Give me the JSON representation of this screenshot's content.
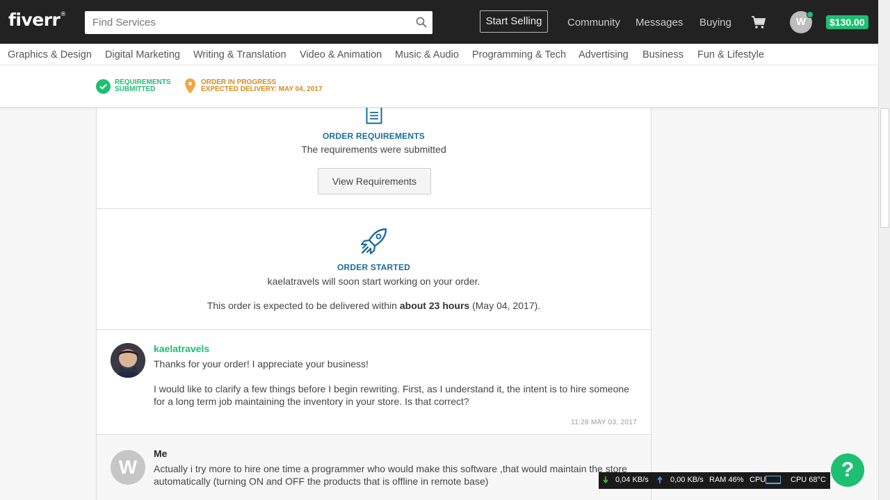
{
  "header": {
    "logo": "fiverr",
    "logo_mark": "®",
    "search_placeholder": "Find Services",
    "search_icon": "search-icon",
    "start_selling": "Start Selling",
    "nav": [
      "Community",
      "Messages",
      "Buying"
    ],
    "cart_icon": "cart-icon",
    "avatar_initial": "W",
    "balance": "$130.00",
    "colors": {
      "bar": "#222222",
      "brand_green": "#1dbf73"
    }
  },
  "categories": [
    "Graphics & Design",
    "Digital Marketing",
    "Writing & Translation",
    "Video & Animation",
    "Music & Audio",
    "Programming & Tech",
    "Advertising",
    "Business",
    "Fun & Lifestyle"
  ],
  "status": {
    "requirements_line1": "REQUIREMENTS",
    "requirements_line2": "SUBMITTED",
    "progress_line1": "ORDER IN PROGRESS",
    "progress_line2": "EXPECTED DELIVERY: MAY 04, 2017",
    "colors": {
      "done": "#1dbf73",
      "in_progress": "#d68a1f"
    }
  },
  "requirements": {
    "icon": "document-icon",
    "title": "ORDER REQUIREMENTS",
    "text": "The requirements were submitted",
    "button": "View Requirements"
  },
  "started": {
    "icon": "rocket-icon",
    "title": "ORDER STARTED",
    "text": "kaelatravels will soon start working on your order.",
    "delivery_prefix": "This order is expected to be delivered within",
    "delivery_bold": "about 23 hours",
    "delivery_suffix": "(May 04, 2017)."
  },
  "messages": [
    {
      "name": "kaelatravels",
      "para1": "Thanks for your order! I appreciate your business!",
      "para2": "I would like to clarify a few things before I begin rewriting. First, as I understand it, the intent is to hire someone for a long term job maintaining the inventory in your store. Is that correct?",
      "time": "11:28  MAY 03, 2017"
    },
    {
      "name": "Me",
      "initial": "W",
      "para1": "Actually i try more to hire one time a programmer who would make this software ,that would maintain the store automatically (turning ON and OFF the products that is offline in remote base)"
    }
  ],
  "help": "?",
  "sysmon": {
    "down": "0,04 KB/s",
    "up": "0,00 KB/s",
    "ram": "RAM 46%",
    "cpu_label": "CPU",
    "cpu_temp": "CPU 68°C"
  }
}
